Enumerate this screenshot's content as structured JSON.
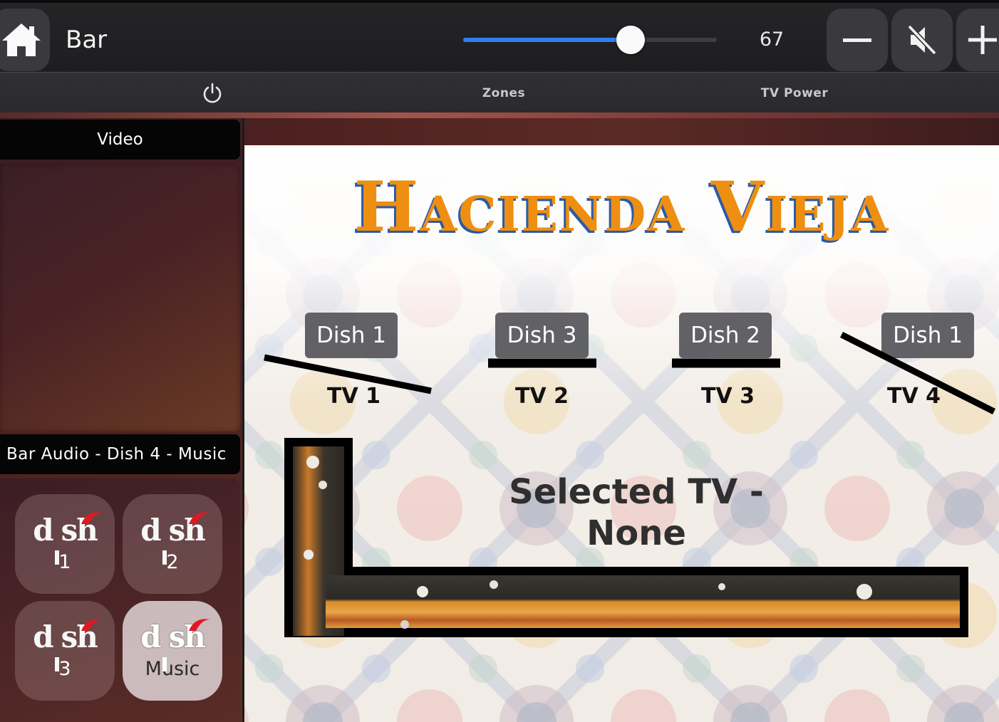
{
  "header": {
    "zone_name": "Bar",
    "volume": {
      "value": 67,
      "max": 100,
      "display": "67",
      "fill_fraction": 0.66
    },
    "colors": {
      "slider_fill": "#2f7ef0",
      "button_bg": "#3a3a3e"
    },
    "buttons": {
      "home_icon": "home-icon",
      "volume_down_icon": "minus-icon",
      "mute_icon": "speaker-muted-icon",
      "volume_up_icon": "plus-icon"
    }
  },
  "nav": {
    "power_icon": "power-icon",
    "zones_label": "Zones",
    "tv_power_label": "TV Power"
  },
  "left": {
    "video_header": "Video",
    "audio_header": "Bar Audio - Dish 4 - Music",
    "sources": [
      {
        "logo": "dish",
        "label": "1",
        "active": false
      },
      {
        "logo": "dish",
        "label": "2",
        "active": false
      },
      {
        "logo": "dish",
        "label": "3",
        "active": false
      },
      {
        "logo": "dish",
        "label": "Music",
        "active": true
      }
    ]
  },
  "map": {
    "title": "Hacienda Vieja",
    "title_colors": {
      "fill": "#ee8f12",
      "shadow": "#2c5aa5"
    },
    "tvs": [
      {
        "dish": "Dish 1",
        "tv": "TV 1"
      },
      {
        "dish": "Dish 3",
        "tv": "TV 2"
      },
      {
        "dish": "Dish 2",
        "tv": "TV 3"
      },
      {
        "dish": "Dish 1",
        "tv": "TV 4"
      }
    ],
    "selected_tv_text": "Selected TV -",
    "selected_tv_value": "None"
  }
}
